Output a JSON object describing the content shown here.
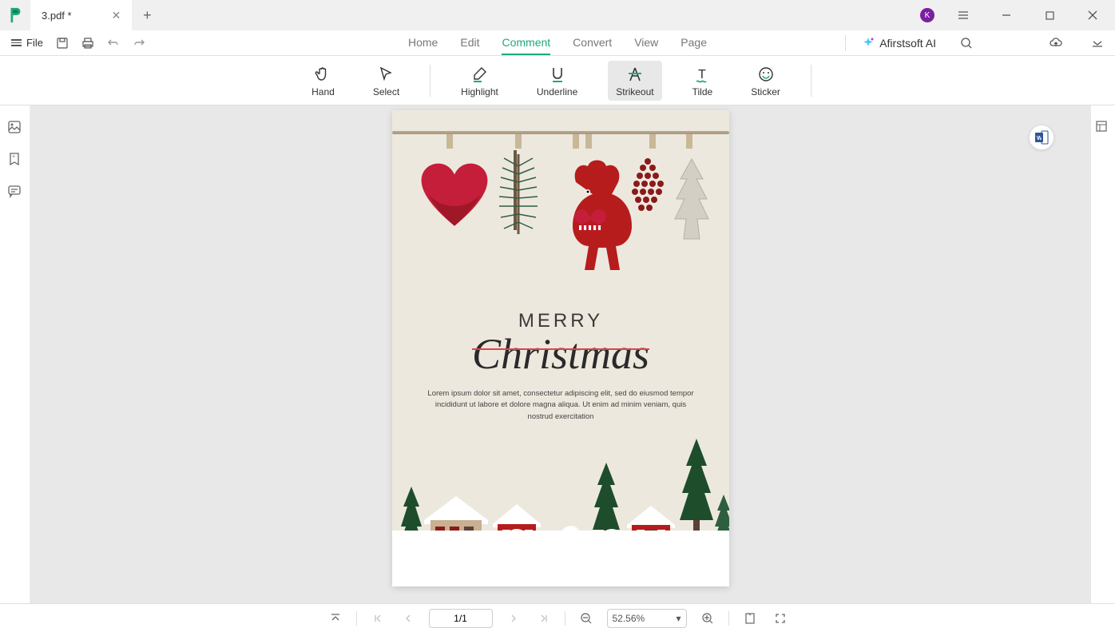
{
  "titlebar": {
    "tab_name": "3.pdf *",
    "avatar_letter": "K"
  },
  "menubar": {
    "file": "File",
    "items": [
      "Home",
      "Edit",
      "Comment",
      "Convert",
      "View",
      "Page"
    ],
    "active_index": 2,
    "ai_label": "Afirstsoft AI"
  },
  "toolbar": {
    "tools": [
      {
        "label": "Hand"
      },
      {
        "label": "Select"
      },
      {
        "label": "Highlight"
      },
      {
        "label": "Underline"
      },
      {
        "label": "Strikeout"
      },
      {
        "label": "Tilde"
      },
      {
        "label": "Sticker"
      }
    ],
    "selected_index": 4
  },
  "document": {
    "title_line1": "MERRY",
    "title_line2": "Christmas",
    "body_text": "Lorem ipsum dolor sit amet, consectetur adipiscing elit, sed do eiusmod tempor incididunt ut labore et dolore magna aliqua. Ut enim ad minim veniam, quis nostrud exercitation"
  },
  "statusbar": {
    "page_display": "1/1",
    "zoom_display": "52.56%"
  }
}
